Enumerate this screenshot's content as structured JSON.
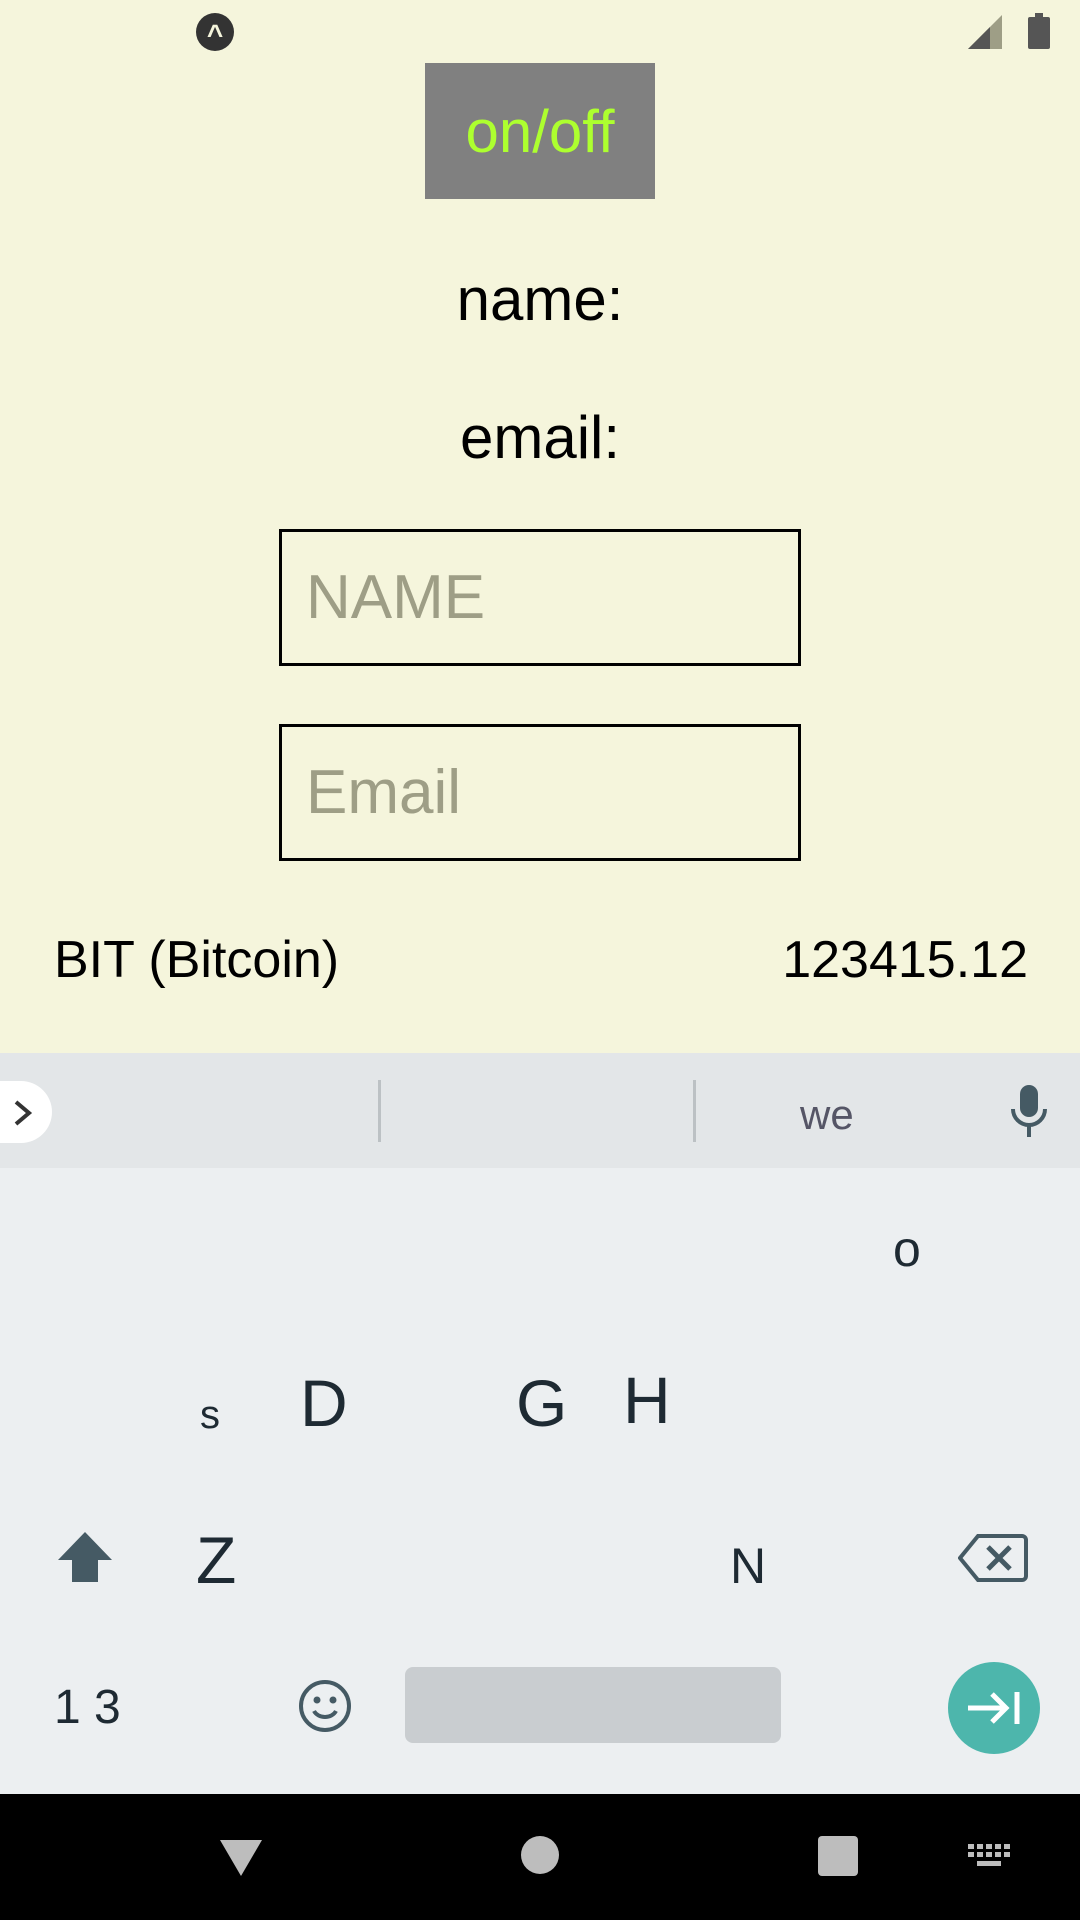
{
  "status_bar": {
    "notification_icon": "caret-up-icon",
    "signal_icon": "signal-icon",
    "battery_icon": "battery-icon"
  },
  "app": {
    "toggle_label": "on/off",
    "name_label": "name:",
    "email_label": "email:",
    "name_placeholder": "NAME",
    "email_placeholder": "Email",
    "currency_name": "BIT (Bitcoin)",
    "currency_value": "123415.12",
    "colors": {
      "background": "#f5f5dc",
      "toggle_bg": "#808080",
      "toggle_text": "#adff2f"
    }
  },
  "keyboard": {
    "suggestion_3": "we",
    "visible_keys": {
      "o": "o",
      "s": "s",
      "d": "D",
      "g": "G",
      "h": "H",
      "z": "Z",
      "n": "N",
      "numbers": "1 3"
    },
    "accent": "#4db6ac"
  },
  "nav_bar": {
    "back": "back-icon",
    "home": "home-icon",
    "recents": "recents-icon",
    "keyboard": "keyboard-icon"
  }
}
